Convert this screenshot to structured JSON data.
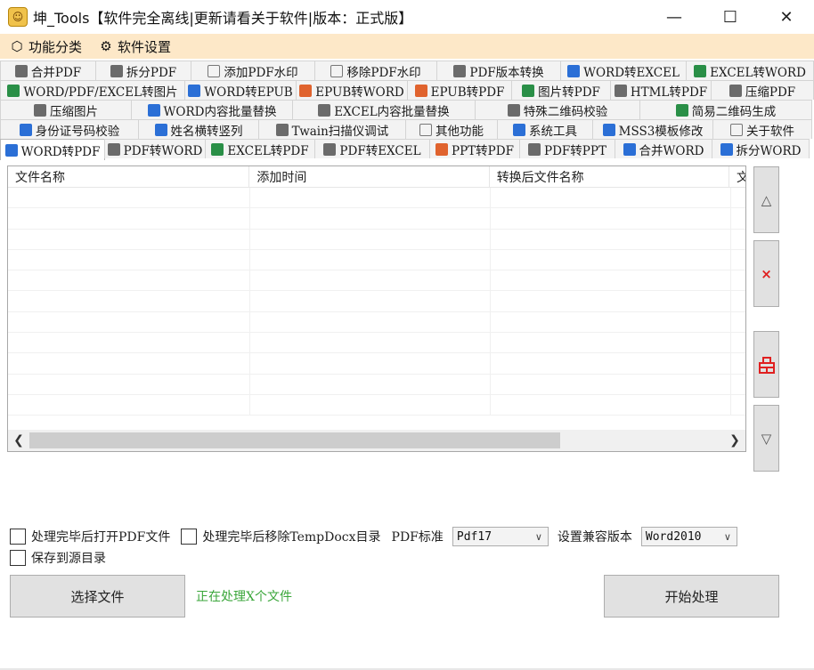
{
  "window": {
    "icon": "app-logo-icon",
    "title": "坤_Tools【软件完全离线|更新请看关于软件|版本：正式版】",
    "controls": {
      "minimize": "—",
      "maximize": "☐",
      "close": "✕"
    }
  },
  "menu": [
    {
      "icon": "category-icon",
      "glyph": "⬡",
      "label": "功能分类"
    },
    {
      "icon": "gear-icon",
      "glyph": "⚙",
      "label": "软件设置"
    }
  ],
  "tab_rows": [
    [
      {
        "label": "合并PDF",
        "icon": "pdf-icon",
        "style": "ic-gray",
        "w": 108
      },
      {
        "label": "拆分PDF",
        "icon": "pdf-icon",
        "style": "ic-gray",
        "w": 108
      },
      {
        "label": "添加PDF水印",
        "icon": "watermark-icon",
        "style": "ic-ring",
        "w": 140
      },
      {
        "label": "移除PDF水印",
        "icon": "watermark-icon",
        "style": "ic-ring",
        "w": 138
      },
      {
        "label": "PDF版本转换",
        "icon": "pdf-icon",
        "style": "ic-gray",
        "w": 140
      },
      {
        "label": "WORD转EXCEL",
        "icon": "word-icon",
        "style": "ic-blue",
        "w": 142
      },
      {
        "label": "EXCEL转WORD",
        "icon": "excel-icon",
        "style": "ic-green",
        "w": 144
      }
    ],
    [
      {
        "label": "WORD/PDF/EXCEL转图片",
        "icon": "image-icon",
        "style": "ic-green",
        "w": 208
      },
      {
        "label": "WORD转EPUB",
        "icon": "word-icon",
        "style": "ic-blue",
        "w": 126
      },
      {
        "label": "EPUB转WORD",
        "icon": "epub-icon",
        "style": "ic-orange",
        "w": 126
      },
      {
        "label": "EPUB转PDF",
        "icon": "epub-icon",
        "style": "ic-orange",
        "w": 118
      },
      {
        "label": "图片转PDF",
        "icon": "image-icon",
        "style": "ic-green",
        "w": 112
      },
      {
        "label": "HTML转PDF",
        "icon": "pdf-icon",
        "style": "ic-gray",
        "w": 114
      },
      {
        "label": "压缩PDF",
        "icon": "compress-icon",
        "style": "ic-gray",
        "w": 116
      }
    ],
    [
      {
        "label": "压缩图片",
        "icon": "compress-icon",
        "style": "ic-gray",
        "w": 148
      },
      {
        "label": "WORD内容批量替换",
        "icon": "word-icon",
        "style": "ic-blue",
        "w": 182
      },
      {
        "label": "EXCEL内容批量替换",
        "icon": "pdf-icon",
        "style": "ic-gray",
        "w": 206
      },
      {
        "label": "特殊二维码校验",
        "icon": "scan-icon",
        "style": "ic-gray",
        "w": 186
      },
      {
        "label": "简易二维码生成",
        "icon": "qrcode-icon",
        "style": "ic-green",
        "w": 194
      }
    ],
    [
      {
        "label": "身份证号码校验",
        "icon": "id-card-icon",
        "style": "ic-blue",
        "w": 156
      },
      {
        "label": "姓名横转竖列",
        "icon": "list-icon",
        "style": "ic-blue",
        "w": 136
      },
      {
        "label": "Twain扫描仪调试",
        "icon": "scanner-icon",
        "style": "ic-gray",
        "w": 166
      },
      {
        "label": "其他功能",
        "icon": "more-icon",
        "style": "ic-ring",
        "w": 104
      },
      {
        "label": "系统工具",
        "icon": "gear-icon",
        "style": "ic-blue",
        "w": 108
      },
      {
        "label": "MSS3模板修改",
        "icon": "gear-icon",
        "style": "ic-blue",
        "w": 136
      },
      {
        "label": "关于软件",
        "icon": "info-icon",
        "style": "ic-ring",
        "w": 112
      }
    ],
    [
      {
        "label": "WORD转PDF",
        "icon": "word-icon",
        "style": "ic-blue",
        "w": 118,
        "active": true
      },
      {
        "label": "PDF转WORD",
        "icon": "pdf-icon",
        "style": "ic-gray",
        "w": 114
      },
      {
        "label": "EXCEL转PDF",
        "icon": "excel-icon",
        "style": "ic-green",
        "w": 124
      },
      {
        "label": "PDF转EXCEL",
        "icon": "pdf-icon",
        "style": "ic-gray",
        "w": 130
      },
      {
        "label": "PPT转PDF",
        "icon": "ppt-icon",
        "style": "ic-orange",
        "w": 102
      },
      {
        "label": "PDF转PPT",
        "icon": "pdf-icon",
        "style": "ic-gray",
        "w": 108
      },
      {
        "label": "合并WORD",
        "icon": "word-icon",
        "style": "ic-blue",
        "w": 110
      },
      {
        "label": "拆分WORD",
        "icon": "word-icon",
        "style": "ic-blue",
        "w": 110
      }
    ]
  ],
  "list": {
    "columns": [
      "文件名称",
      "添加时间",
      "转换后文件名称",
      "文"
    ],
    "rows": []
  },
  "side_buttons": {
    "move_up": "△",
    "delete": "×",
    "clear": "clear-icon",
    "move_down": "▽"
  },
  "options": {
    "open_pdf_after": "处理完毕后打开PDF文件",
    "remove_temp": "处理完毕后移除TempDocx目录",
    "pdf_standard_label": "PDF标准",
    "pdf_standard_value": "Pdf17",
    "compat_label": "设置兼容版本",
    "compat_value": "Word2010",
    "save_to_source": "保存到源目录"
  },
  "actions": {
    "select_files": "选择文件",
    "status": "正在处理X个文件",
    "start": "开始处理"
  }
}
